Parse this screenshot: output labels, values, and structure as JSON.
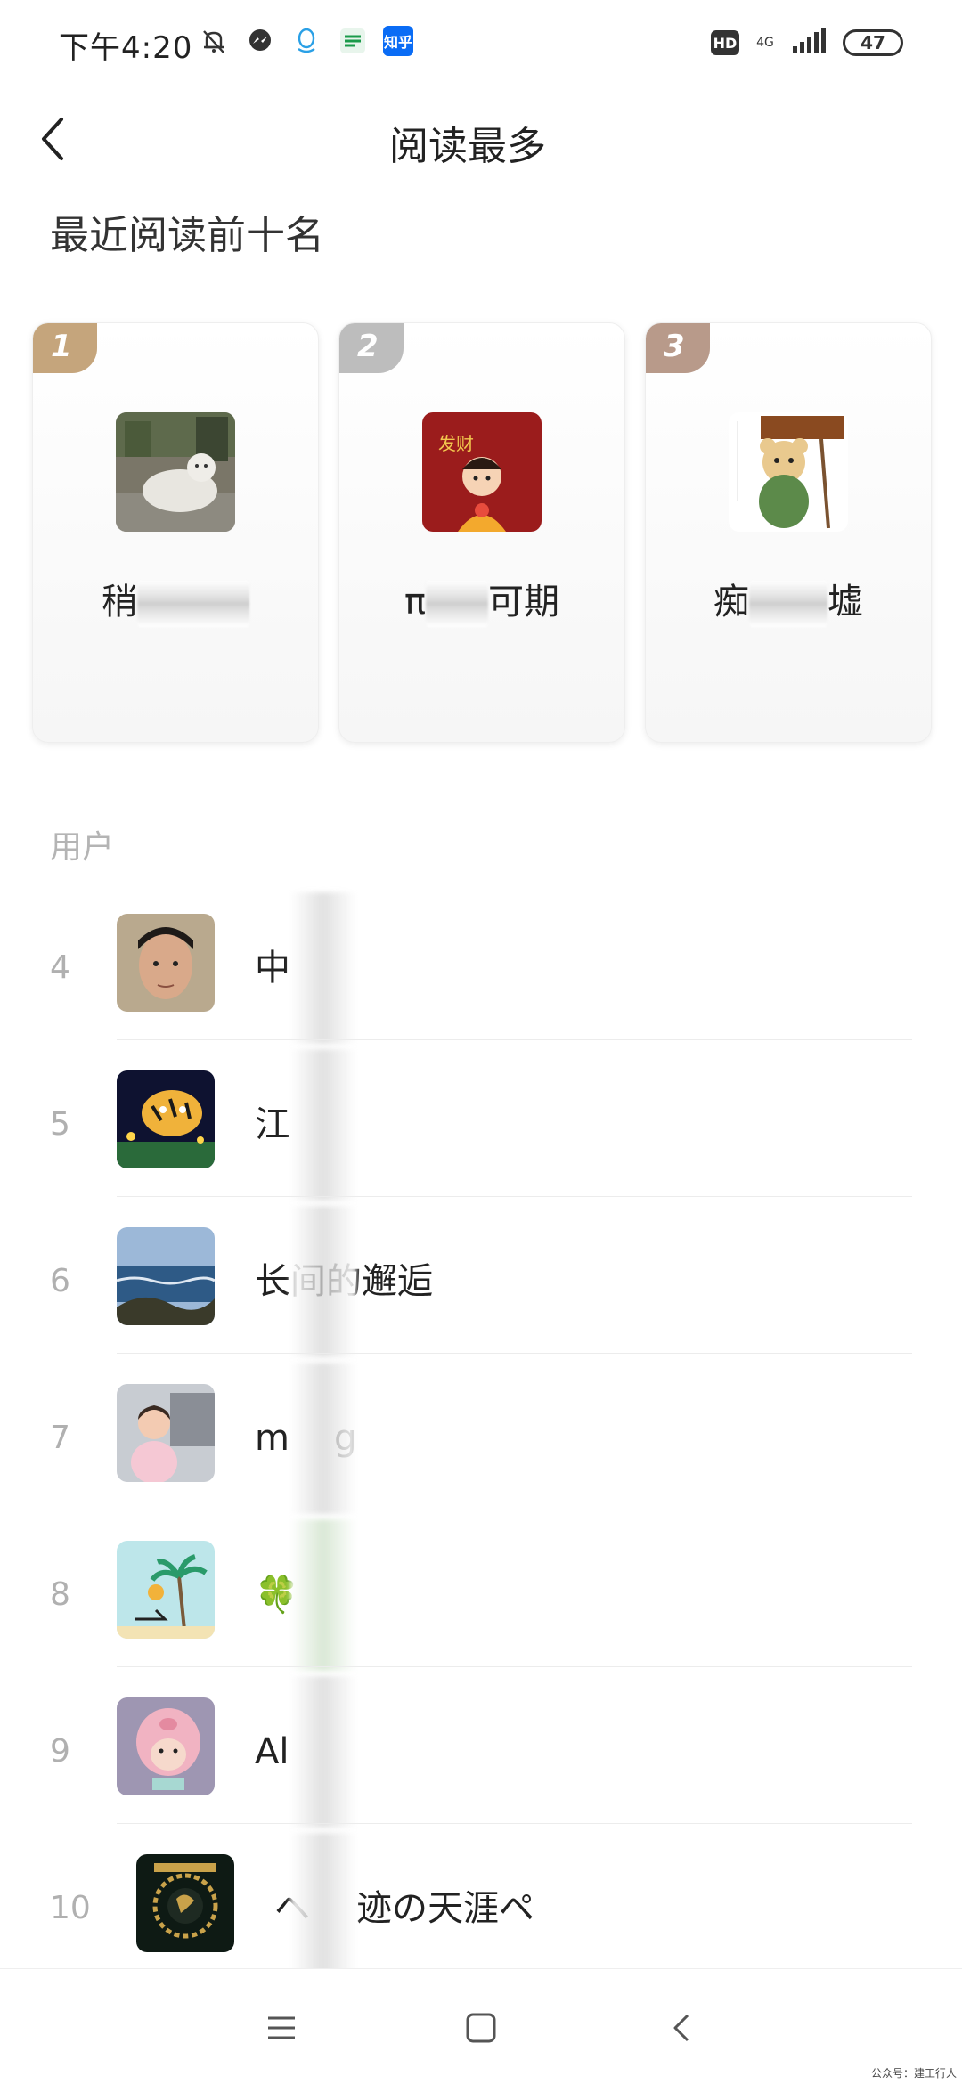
{
  "status_bar": {
    "time": "下午4:20",
    "left_icons": [
      "bell-off-icon",
      "messenger-icon",
      "qq-icon",
      "post-icon",
      "zhihu-icon"
    ],
    "zhihu_label": "知乎",
    "hd_label": "HD",
    "network_label": "4G",
    "battery": "47"
  },
  "header": {
    "title": "阅读最多",
    "back_icon": "chevron-left-icon"
  },
  "top_section": {
    "title": "最近阅读前十名",
    "cards": [
      {
        "rank": "1",
        "name_prefix": "稍",
        "name_suffix": "",
        "badge_color": "#c5a57c"
      },
      {
        "rank": "2",
        "name_prefix": "π",
        "name_suffix": "可期",
        "badge_color": "#bdbdbd"
      },
      {
        "rank": "3",
        "name_prefix": "痴",
        "name_suffix": "墟",
        "badge_color": "#b89a8a"
      }
    ]
  },
  "user_section": {
    "label": "用户",
    "users": [
      {
        "rank": "4",
        "name_prefix": "中",
        "name_suffix": ""
      },
      {
        "rank": "5",
        "name_prefix": "江",
        "name_suffix": ""
      },
      {
        "rank": "6",
        "name_prefix": "长",
        "name_suffix": "间的邂逅"
      },
      {
        "rank": "7",
        "name_prefix": "m",
        "name_suffix": "g"
      },
      {
        "rank": "8",
        "name_prefix": "🍀",
        "name_suffix": ""
      },
      {
        "rank": "9",
        "name_prefix": "Al",
        "name_suffix": ""
      },
      {
        "rank": "10",
        "name_prefix": "ヘ",
        "name_suffix": "迹の天涯ペ"
      }
    ]
  },
  "nav_bar": {
    "buttons": [
      "menu-icon",
      "home-square-icon",
      "back-triangle-icon"
    ]
  },
  "watermark": "公众号：建工行人"
}
